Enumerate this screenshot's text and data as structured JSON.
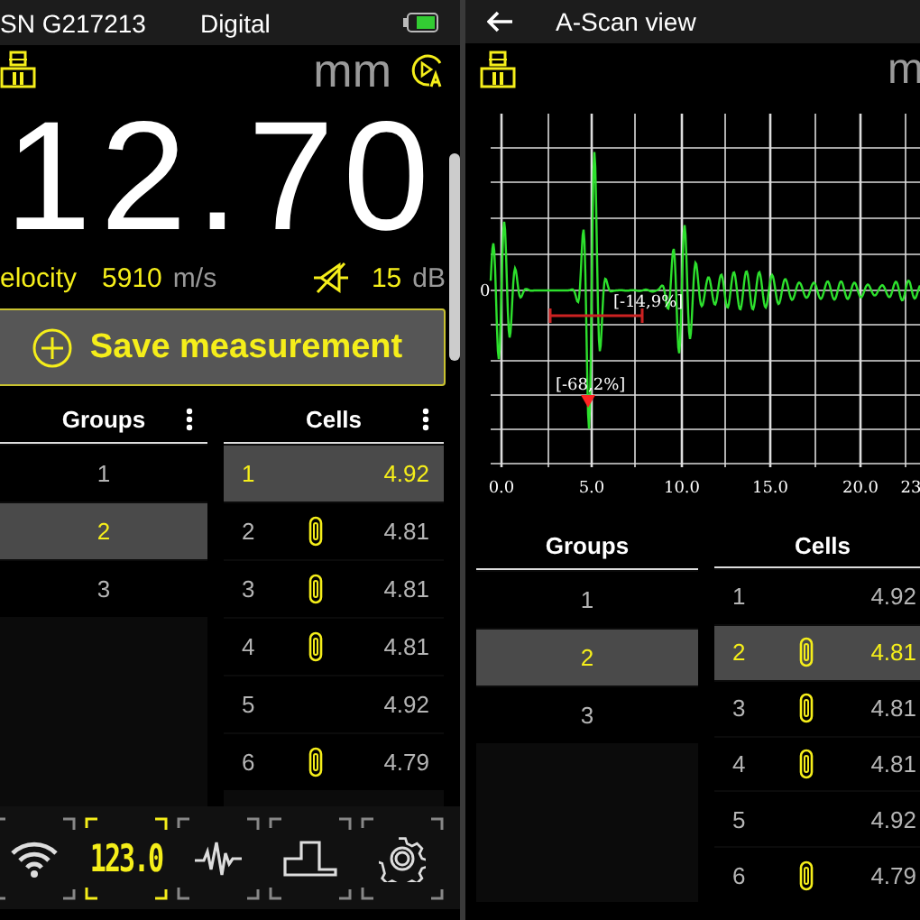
{
  "left_screen": {
    "status_bar": {
      "serial": "SN G217213",
      "mode": "Digital"
    },
    "unit": "mm",
    "reading": "12.70",
    "velocity": {
      "label": "elocity",
      "value": "5910",
      "unit": "m/s"
    },
    "gain": {
      "value": "15",
      "unit": "dB"
    },
    "save_button": "Save measurement",
    "groups": {
      "title": "Groups",
      "rows": [
        {
          "label": "1",
          "selected": false
        },
        {
          "label": "2",
          "selected": true
        },
        {
          "label": "3",
          "selected": false
        }
      ]
    },
    "cells": {
      "title": "Cells",
      "rows": [
        {
          "index": "1",
          "value": "4.92",
          "attached": false,
          "selected": true
        },
        {
          "index": "2",
          "value": "4.81",
          "attached": true,
          "selected": false
        },
        {
          "index": "3",
          "value": "4.81",
          "attached": true,
          "selected": false
        },
        {
          "index": "4",
          "value": "4.81",
          "attached": true,
          "selected": false
        },
        {
          "index": "5",
          "value": "4.92",
          "attached": false,
          "selected": false
        },
        {
          "index": "6",
          "value": "4.79",
          "attached": true,
          "selected": false
        }
      ]
    },
    "nav": [
      {
        "kind": "wifi",
        "selected": false
      },
      {
        "kind": "digits",
        "label": "123.0",
        "selected": true
      },
      {
        "kind": "wave",
        "selected": false
      },
      {
        "kind": "step",
        "selected": false
      },
      {
        "kind": "gear",
        "selected": false
      }
    ]
  },
  "right_screen": {
    "title": "A-Scan view",
    "unit": "m",
    "ascan": {
      "zero_label": "0",
      "x_ticks": [
        "0.0",
        "5.0",
        "10.0",
        "15.0",
        "20.0",
        "23"
      ],
      "gate_label": "[-14,9%]",
      "peak_label": "[-68,2%]"
    },
    "groups": {
      "title": "Groups",
      "rows": [
        {
          "label": "1",
          "selected": false
        },
        {
          "label": "2",
          "selected": true
        },
        {
          "label": "3",
          "selected": false
        }
      ]
    },
    "cells": {
      "title": "Cells",
      "rows": [
        {
          "index": "1",
          "value": "4.92",
          "attached": false,
          "selected": false
        },
        {
          "index": "2",
          "value": "4.81",
          "attached": true,
          "selected": true
        },
        {
          "index": "3",
          "value": "4.81",
          "attached": true,
          "selected": false
        },
        {
          "index": "4",
          "value": "4.81",
          "attached": true,
          "selected": false
        },
        {
          "index": "5",
          "value": "4.92",
          "attached": false,
          "selected": false
        },
        {
          "index": "6",
          "value": "4.79",
          "attached": true,
          "selected": false
        }
      ]
    }
  }
}
